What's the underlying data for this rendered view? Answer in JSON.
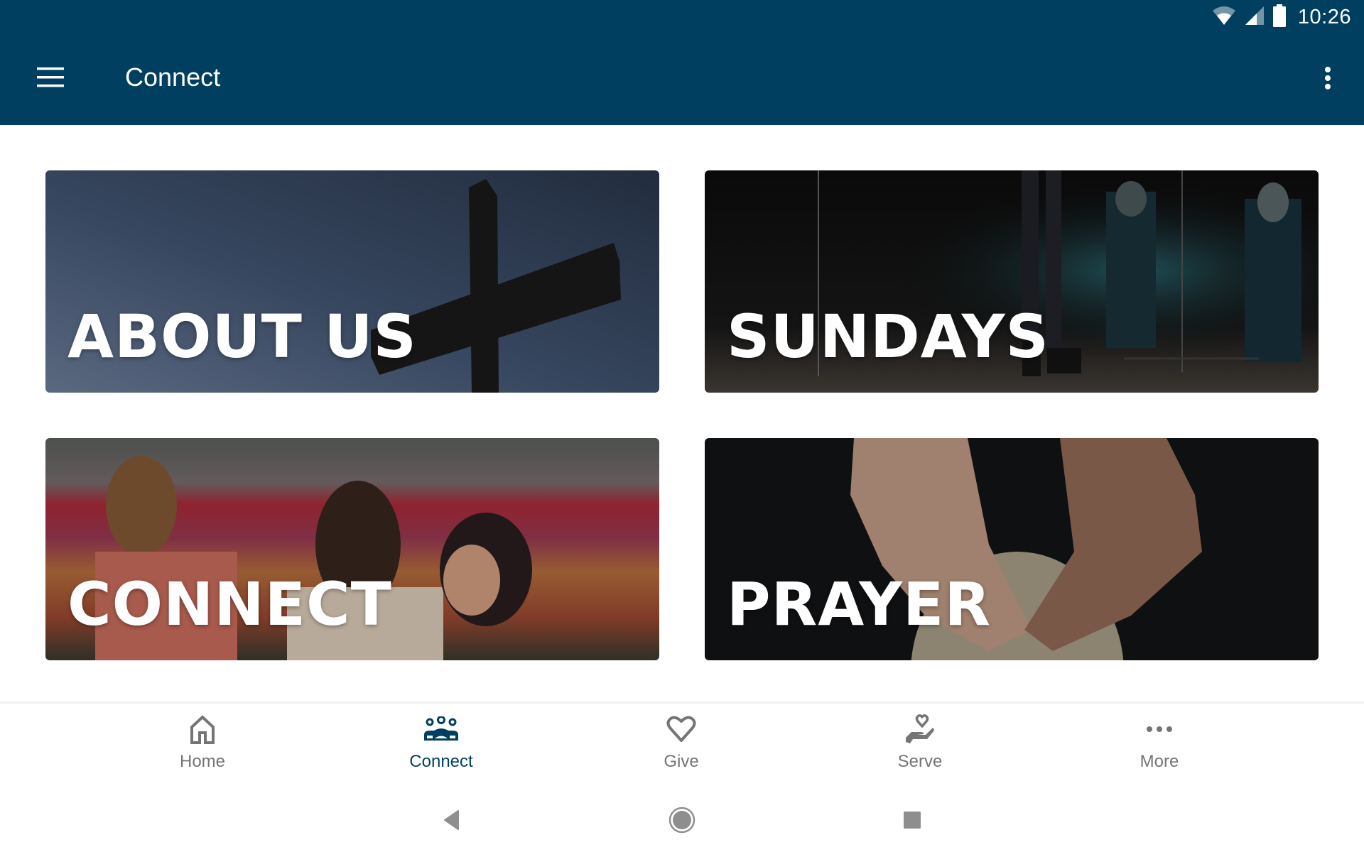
{
  "status_bar": {
    "time": "10:26",
    "icons": [
      "wifi-icon",
      "cellular-signal-icon",
      "battery-icon"
    ]
  },
  "app_bar": {
    "title": "Connect",
    "menu_icon": "hamburger-menu-icon",
    "overflow_icon": "more-vertical-icon",
    "background_color": "#003f5f"
  },
  "cards": [
    {
      "label": "ABOUT US",
      "image": "cross silhouette against dusk sky"
    },
    {
      "label": "SUNDAYS",
      "image": "stage with microphone stands and people"
    },
    {
      "label": "CONNECT",
      "image": "three women laughing in tulip field"
    },
    {
      "label": "PRAYER",
      "image": "open hands held out"
    }
  ],
  "bottom_nav": {
    "active_color": "#003f5f",
    "inactive_color": "#757575",
    "items": [
      {
        "label": "Home",
        "icon": "home-icon",
        "active": false
      },
      {
        "label": "Connect",
        "icon": "people-group-icon",
        "active": true
      },
      {
        "label": "Give",
        "icon": "heart-icon",
        "active": false
      },
      {
        "label": "Serve",
        "icon": "hand-heart-icon",
        "active": false
      },
      {
        "label": "More",
        "icon": "more-horizontal-icon",
        "active": false
      }
    ]
  },
  "system_nav": {
    "buttons": [
      "back-icon",
      "home-circle-icon",
      "recents-square-icon"
    ]
  }
}
